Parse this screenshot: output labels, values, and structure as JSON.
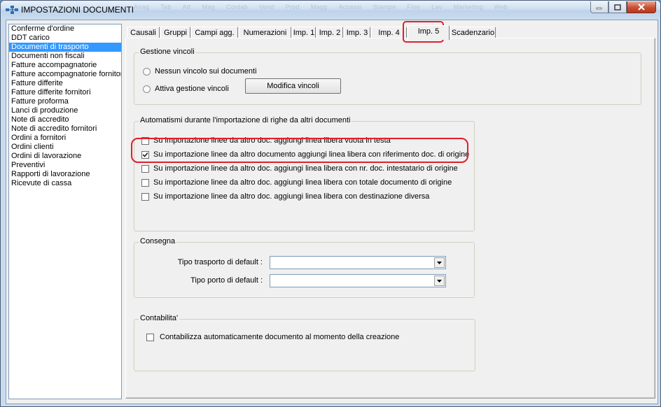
{
  "window": {
    "title": "IMPOSTAZIONI DOCUMENTI",
    "background_menu": [
      "Anag",
      "Tab",
      "Att",
      "Mag",
      "Contab",
      "Vend",
      "Prod",
      "Magg",
      "Accessi",
      "Stampe",
      "Fine",
      "Lav",
      "Marketing",
      "Web"
    ]
  },
  "sidebar": {
    "items": [
      "Conferme d'ordine",
      "DDT carico",
      "Documenti di trasporto",
      "Documenti non fiscali",
      "Fatture accompagnatorie",
      "Fatture accompagnatorie fornitori",
      "Fatture differite",
      "Fatture differite fornitori",
      "Fatture proforma",
      "Lanci di produzione",
      "Note di accredito",
      "Note di accredito fornitori",
      "Ordini a fornitori",
      "Ordini clienti",
      "Ordini di lavorazione",
      "Preventivi",
      "Rapporti di lavorazione",
      "Ricevute di cassa"
    ],
    "selected_index": 2
  },
  "tabs": [
    {
      "label": "Causali"
    },
    {
      "label": "Gruppi"
    },
    {
      "label": "Campi agg."
    },
    {
      "label": "Numerazioni"
    },
    {
      "label": "Imp. 1"
    },
    {
      "label": "Imp. 2"
    },
    {
      "label": "Imp. 3"
    },
    {
      "label": "Imp. 4"
    },
    {
      "label": "Imp. 5"
    },
    {
      "label": "Scadenzario"
    }
  ],
  "active_tab": "Imp. 5",
  "gestione_vincoli": {
    "title": "Gestione vincoli",
    "option_none": "Nessun vincolo sui documenti",
    "option_active": "Attiva gestione vincoli",
    "modify_button": "Modifica vincoli"
  },
  "automatismi": {
    "title": "Automatismi durante l'importazione di righe da altri documenti",
    "options": [
      {
        "label": "Su importazione linee da altro doc. aggiungi linea libera vuota in testa",
        "checked": false
      },
      {
        "label": "Su importazione linee da altro documento aggiungi linea libera con riferimento doc. di origine",
        "checked": true
      },
      {
        "label": "Su importazione linee da altro doc. aggiungi linea libera con nr. doc. intestatario di origine",
        "checked": false
      },
      {
        "label": "Su importazione linee da altro doc. aggiungi linea libera con totale documento di origine",
        "checked": false
      },
      {
        "label": "Su importazione linee da altro doc. aggiungi linea libera con destinazione diversa",
        "checked": false
      }
    ]
  },
  "consegna": {
    "title": "Consegna",
    "trasporto_label": "Tipo trasporto di default :",
    "trasporto_value": "",
    "porto_label": "Tipo porto di default :",
    "porto_value": ""
  },
  "contabilita": {
    "title": "Contabilita'",
    "option": "Contabilizza automaticamente documento al momento della creazione",
    "checked": false
  },
  "highlight_color": "#e0202a"
}
